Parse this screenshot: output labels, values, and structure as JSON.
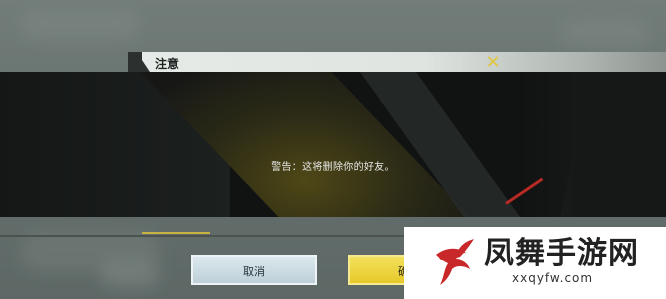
{
  "dialog": {
    "title": "注意",
    "close_icon": "close-x-icon",
    "message": "警告：这将删除你的好友。"
  },
  "buttons": {
    "cancel": "取消",
    "confirm": "确"
  },
  "watermark": {
    "title": "凤舞手游网",
    "subtitle": "xxqyfw.com"
  },
  "colors": {
    "accent_yellow": "#e6c92a",
    "close_icon": "#e2c640",
    "cancel_button": "#c6d7de",
    "panel_background": "#111312"
  }
}
